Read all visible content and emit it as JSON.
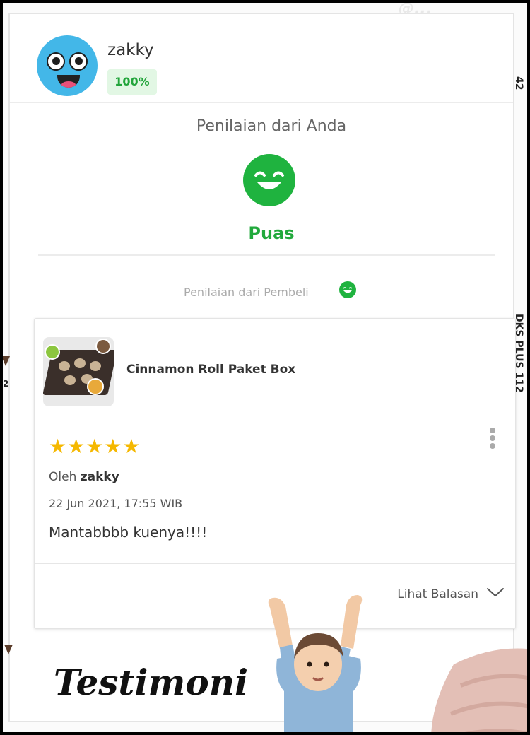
{
  "watermark": "@...",
  "side": {
    "right_top": "42",
    "right_mid": "DKS PLUS 112",
    "left_mid": "2"
  },
  "user": {
    "name": "zakky",
    "percent": "100%"
  },
  "rating": {
    "title": "Penilaian dari Anda",
    "value": "Puas",
    "buyer_label": "Penilaian dari Pembeli",
    "smiley_icon": "happy-face-icon",
    "color": "#1fb33f"
  },
  "review": {
    "product_name": "Cinnamon Roll Paket Box",
    "stars": 5,
    "stars_text": "★★★★★",
    "by_prefix": "Oleh",
    "by_user": "zakky",
    "date": "22 Jun 2021, 17:55 WIB",
    "text": "Mantabbbb kuenya!!!!",
    "reply_label": "Lihat Balasan"
  },
  "overlay": {
    "testimoni": "Testimoni"
  },
  "colors": {
    "accent_green": "#21a93c",
    "star": "#f5b800",
    "badge_bg": "#e2f7e4"
  }
}
